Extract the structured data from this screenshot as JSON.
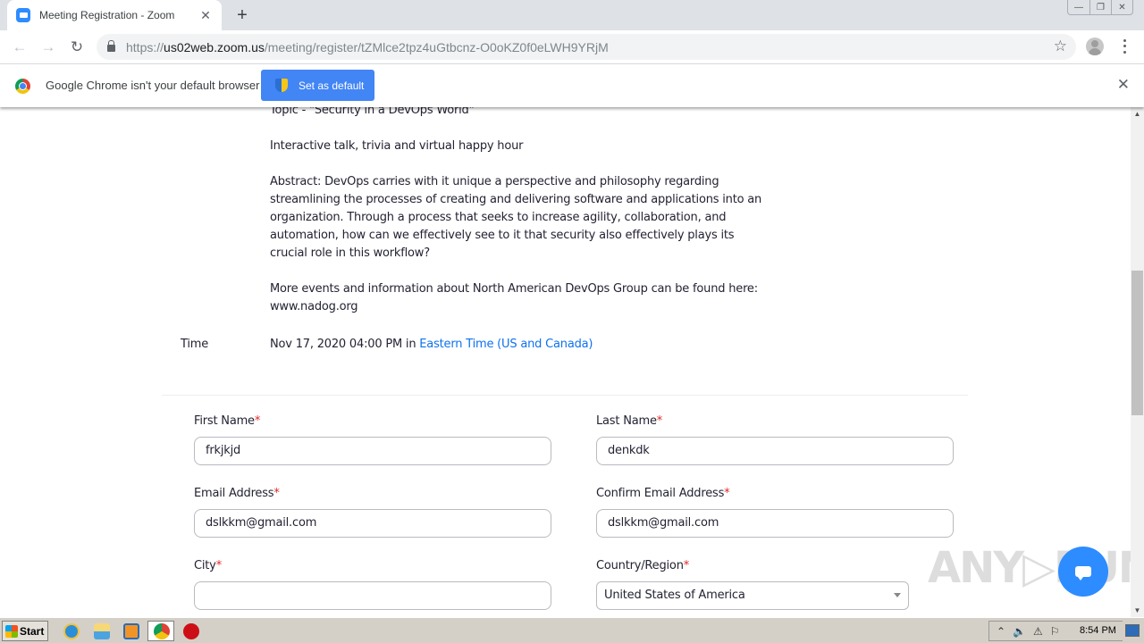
{
  "browser": {
    "tab": {
      "title": "Meeting Registration - Zoom",
      "favicon": "zoom-icon",
      "close_glyph": "✕"
    },
    "new_tab_glyph": "+",
    "window_controls": {
      "minimize": "—",
      "restore": "❐",
      "close": "✕"
    },
    "nav": {
      "back": "←",
      "forward": "→",
      "reload": "↻"
    },
    "url": {
      "scheme": "https://",
      "host": "us02web.zoom.us",
      "path": "/meeting/register/tZMlce2tpz4uGtbcnz-O0oKZ0f0eLWH9YRjM"
    },
    "bookmark_glyph": "☆",
    "infobar": {
      "message": "Google Chrome isn't your default browser",
      "button_label": "Set as default",
      "close_glyph": "✕"
    }
  },
  "meeting": {
    "topic_line": "Topic - \"Security in a DevOps World\"",
    "subtitle": "Interactive talk, trivia and virtual happy hour",
    "abstract": "Abstract: DevOps carries with it unique a perspective and philosophy regarding streamlining the processes of creating and delivering software and applications into an organization. Through a process that seeks to increase agility, collaboration, and automation, how can we effectively see to it that security also effectively plays its crucial role in this workflow?",
    "more_info": "More events and information about North American DevOps Group can be found here: www.nadog.org",
    "time_label": "Time",
    "time_value": "Nov 17, 2020 04:00 PM in ",
    "timezone_link": "Eastern Time (US and Canada)"
  },
  "form": {
    "required_marker": "*",
    "first_name": {
      "label": "First Name",
      "value": "frkjkjd"
    },
    "last_name": {
      "label": "Last Name",
      "value": "denkdk"
    },
    "email": {
      "label": "Email Address",
      "value": "dslkkm@gmail.com"
    },
    "confirm_email": {
      "label": "Confirm Email Address",
      "value": "dslkkm@gmail.com"
    },
    "city": {
      "label": "City",
      "value": ""
    },
    "country": {
      "label": "Country/Region",
      "value": "United States of America"
    }
  },
  "watermark": "ANY▷RUN",
  "taskbar": {
    "start_label": "Start",
    "clock": "8:54 PM",
    "tray_icons": [
      "chevron-up-icon",
      "speaker-icon",
      "network-warning-icon",
      "flag-icon"
    ]
  },
  "colors": {
    "zoom_blue": "#2d8cff",
    "link_blue": "#0e72ed",
    "chrome_button_blue": "#4285f4",
    "required_red": "#e02828"
  }
}
